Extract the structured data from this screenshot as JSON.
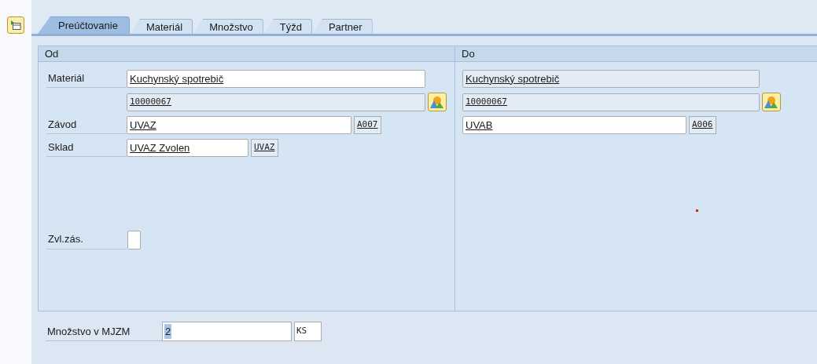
{
  "tabs": [
    {
      "label": "Preúčtovanie",
      "selected": true
    },
    {
      "label": "Materiál",
      "selected": false
    },
    {
      "label": "Množstvo",
      "selected": false
    },
    {
      "label": "Týžd",
      "selected": false
    },
    {
      "label": "Partner",
      "selected": false
    }
  ],
  "from": {
    "title": "Od",
    "material": {
      "label": "Materiál",
      "name": {
        "value": "Kuchynský spotrebič",
        "editable": true
      },
      "number": {
        "value": "10000067",
        "editable": false
      }
    },
    "plant": {
      "label": "Závod",
      "value": "UVAZ",
      "code": "A007"
    },
    "storage": {
      "label": "Sklad",
      "value": "UVAZ Zvolen",
      "code": "UVAZ"
    },
    "special_stock": {
      "label": "Zvl.zás.",
      "checked": false
    }
  },
  "to": {
    "title": "Do",
    "material": {
      "name": {
        "value": "Kuchynský spotrebič",
        "editable": false
      },
      "number": {
        "value": "10000067",
        "editable": false
      }
    },
    "plant": {
      "value": "UVAB",
      "code": "A006"
    }
  },
  "quantity": {
    "label": "Množstvo v MJZM",
    "value": "2",
    "unit": "KS"
  }
}
